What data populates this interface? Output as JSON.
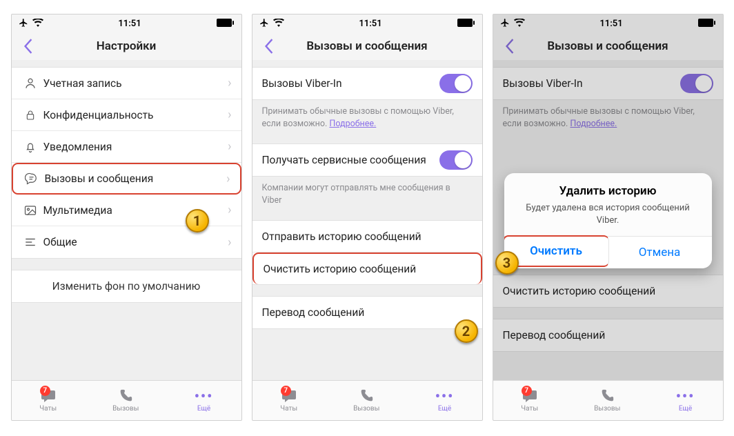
{
  "status": {
    "time": "11:51"
  },
  "panel1": {
    "title": "Настройки",
    "items": {
      "account": "Учетная запись",
      "privacy": "Конфиденциальность",
      "notifications": "Уведомления",
      "calls_messages": "Вызовы и сообщения",
      "media": "Мультимедиа",
      "general": "Общие",
      "default_bg": "Изменить фон по умолчанию"
    },
    "step": "1"
  },
  "panel2": {
    "title": "Вызовы и сообщения",
    "viber_in": "Вызовы Viber-In",
    "viber_in_desc_a": "Принимать обычные вызовы с помощью Viber, если возможно. ",
    "viber_in_desc_link": "Подробнее.",
    "service_msgs": "Получать сервисные сообщения",
    "service_msgs_desc": "Компании могут отправлять мне сообщения в Viber",
    "send_history": "Отправить историю сообщений",
    "clear_history": "Очистить историю сообщений",
    "translate": "Перевод сообщений",
    "step": "2"
  },
  "panel3": {
    "title": "Вызовы и сообщения",
    "viber_in": "Вызовы Viber-In",
    "viber_in_desc_a": "Принимать обычные вызовы с помощью Viber, если возможно. ",
    "viber_in_desc_link": "Подробнее.",
    "clear_history": "Очистить историю сообщений",
    "translate": "Перевод сообщений",
    "dialog": {
      "title": "Удалить историю",
      "message": "Будет удалена вся история сообщений Viber.",
      "confirm": "Очистить",
      "cancel": "Отмена"
    },
    "step": "3"
  },
  "tabs": {
    "chats": "Чаты",
    "calls": "Вызовы",
    "more": "Ещё",
    "badge": "7"
  }
}
